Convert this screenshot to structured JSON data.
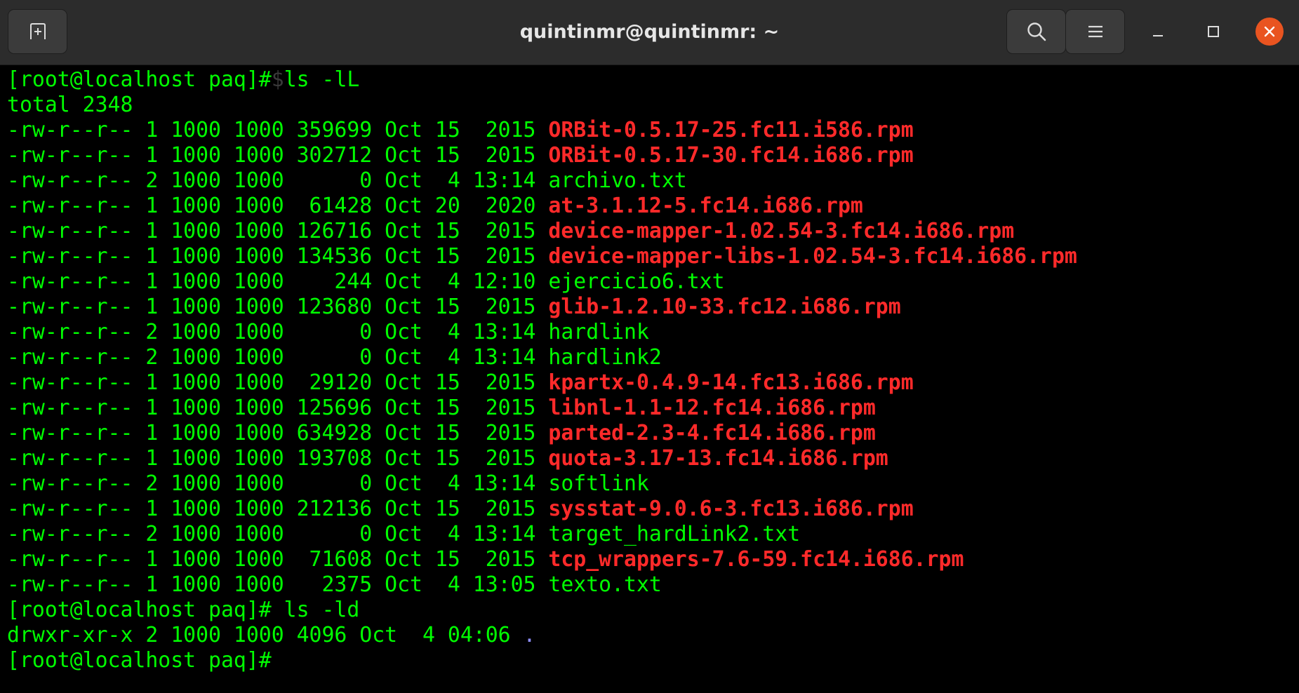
{
  "window": {
    "title": "quintinmr@quintinmr: ~",
    "buttons": {
      "new_tab": "new-tab-icon",
      "search": "search-icon",
      "menu": "hamburger-menu-icon",
      "minimize": "minimize-icon",
      "maximize": "maximize-icon",
      "close": "close-icon"
    },
    "colors": {
      "titlebar": "#2c2c2c",
      "terminal_bg": "#000000",
      "text": "#00ff00",
      "rpm_file": "#ff2a2a",
      "close_button": "#e95420"
    }
  },
  "terminal": {
    "prompt1": "[root@localhost paq]#",
    "ghost1": "$",
    "command1": "ls -lL",
    "total": "total 2348",
    "files": [
      {
        "info": "-rw-r--r-- 1 1000 1000 359699 Oct 15  2015 ",
        "name": "ORBit-0.5.17-25.fc11.i586.rpm",
        "rpm": true
      },
      {
        "info": "-rw-r--r-- 1 1000 1000 302712 Oct 15  2015 ",
        "name": "ORBit-0.5.17-30.fc14.i686.rpm",
        "rpm": true
      },
      {
        "info": "-rw-r--r-- 2 1000 1000      0 Oct  4 13:14 ",
        "name": "archivo.txt",
        "rpm": false
      },
      {
        "info": "-rw-r--r-- 1 1000 1000  61428 Oct 20  2020 ",
        "name": "at-3.1.12-5.fc14.i686.rpm",
        "rpm": true
      },
      {
        "info": "-rw-r--r-- 1 1000 1000 126716 Oct 15  2015 ",
        "name": "device-mapper-1.02.54-3.fc14.i686.rpm",
        "rpm": true
      },
      {
        "info": "-rw-r--r-- 1 1000 1000 134536 Oct 15  2015 ",
        "name": "device-mapper-libs-1.02.54-3.fc14.i686.rpm",
        "rpm": true
      },
      {
        "info": "-rw-r--r-- 1 1000 1000    244 Oct  4 12:10 ",
        "name": "ejercicio6.txt",
        "rpm": false
      },
      {
        "info": "-rw-r--r-- 1 1000 1000 123680 Oct 15  2015 ",
        "name": "glib-1.2.10-33.fc12.i686.rpm",
        "rpm": true
      },
      {
        "info": "-rw-r--r-- 2 1000 1000      0 Oct  4 13:14 ",
        "name": "hardlink",
        "rpm": false
      },
      {
        "info": "-rw-r--r-- 2 1000 1000      0 Oct  4 13:14 ",
        "name": "hardlink2",
        "rpm": false
      },
      {
        "info": "-rw-r--r-- 1 1000 1000  29120 Oct 15  2015 ",
        "name": "kpartx-0.4.9-14.fc13.i686.rpm",
        "rpm": true
      },
      {
        "info": "-rw-r--r-- 1 1000 1000 125696 Oct 15  2015 ",
        "name": "libnl-1.1-12.fc14.i686.rpm",
        "rpm": true
      },
      {
        "info": "-rw-r--r-- 1 1000 1000 634928 Oct 15  2015 ",
        "name": "parted-2.3-4.fc14.i686.rpm",
        "rpm": true
      },
      {
        "info": "-rw-r--r-- 1 1000 1000 193708 Oct 15  2015 ",
        "name": "quota-3.17-13.fc14.i686.rpm",
        "rpm": true
      },
      {
        "info": "-rw-r--r-- 2 1000 1000      0 Oct  4 13:14 ",
        "name": "softlink",
        "rpm": false
      },
      {
        "info": "-rw-r--r-- 1 1000 1000 212136 Oct 15  2015 ",
        "name": "sysstat-9.0.6-3.fc13.i686.rpm",
        "rpm": true
      },
      {
        "info": "-rw-r--r-- 2 1000 1000      0 Oct  4 13:14 ",
        "name": "target_hardLink2.txt",
        "rpm": false
      },
      {
        "info": "-rw-r--r-- 1 1000 1000  71608 Oct 15  2015 ",
        "name": "tcp_wrappers-7.6-59.fc14.i686.rpm",
        "rpm": true
      },
      {
        "info": "-rw-r--r-- 1 1000 1000   2375 Oct  4 13:05 ",
        "name": "texto.txt",
        "rpm": false
      }
    ],
    "prompt2": "[root@localhost paq]#",
    "command2": " ls -ld",
    "dir_info": "drwxr-xr-x 2 1000 1000 4096 Oct  4 04:06 ",
    "dir_name": ".",
    "prompt3": "[root@localhost paq]#"
  }
}
